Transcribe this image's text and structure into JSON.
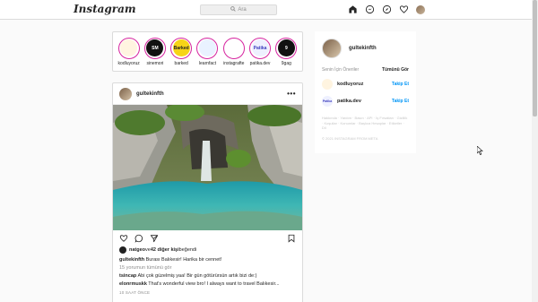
{
  "topbar": {
    "logo": "Instagram",
    "search_placeholder": "Ara",
    "icons": [
      "home-icon",
      "direct-message-icon",
      "explore-icon",
      "heart-icon",
      "profile-avatar"
    ]
  },
  "stories": [
    {
      "label": "kodluyoruz",
      "badge": "",
      "bg": "#fff4e0",
      "fg": "#e08a00"
    },
    {
      "label": "sinemori",
      "badge": "SM",
      "bg": "#111111",
      "fg": "#ffffff"
    },
    {
      "label": "barked",
      "badge": "Barked",
      "bg": "#f7d417",
      "fg": "#222222"
    },
    {
      "label": "learnfact",
      "badge": "",
      "bg": "#e9f2ff",
      "fg": "#3b82f6"
    },
    {
      "label": "instagrafte",
      "badge": "",
      "bg": "#ffffff",
      "fg": "#d6249f"
    },
    {
      "label": "patika.dev",
      "badge": "Patika",
      "bg": "#eef0ff",
      "fg": "#3d3dbd"
    },
    {
      "label": "9gag",
      "badge": "9",
      "bg": "#111111",
      "fg": "#ffffff"
    }
  ],
  "post": {
    "username": "gultekinfth",
    "more_label": "•••",
    "likes_prefix": "natgeo",
    "likes_mid": " ve ",
    "likes_count": "42 diğer kişi",
    "likes_suffix": " beğendi",
    "caption_user": "gultekinfth",
    "caption_text": " Burası Balıkesir! Harika bir cennet!",
    "view_comments": "15 yorumun tümünü gör",
    "comments": [
      {
        "user": "tsincap",
        "text": " Abi çok güzelmiş yaa! Bir gün götürürsün artık bizi de:)"
      },
      {
        "user": "elonrmuskk",
        "text": " That's wonderful view bro! I always want to travel Balıkesir..."
      }
    ],
    "time": "10 SAAT ÖNCE"
  },
  "sidebar": {
    "username": "gultekinfth",
    "suggestions_title": "Senin İçin Öneriler",
    "see_all": "Tümünü Gör",
    "suggestions": [
      {
        "name": "kodluyoruz",
        "follow": "Takip Et",
        "bg": "#fff4e0",
        "fg": "#e08a00",
        "badge": ""
      },
      {
        "name": "patika.dev",
        "follow": "Takip Et",
        "bg": "#eef0ff",
        "fg": "#3d3dbd",
        "badge": "Patika"
      }
    ],
    "footer": "Hakkında · Yardım · Basın · API · İş Fırsatları · Gizlilik · Koşullar · Konumlar · Başlıca Hesaplar · Etiketler · Dil",
    "copyright": "© 2021 INSTAGRAM FROM META"
  }
}
